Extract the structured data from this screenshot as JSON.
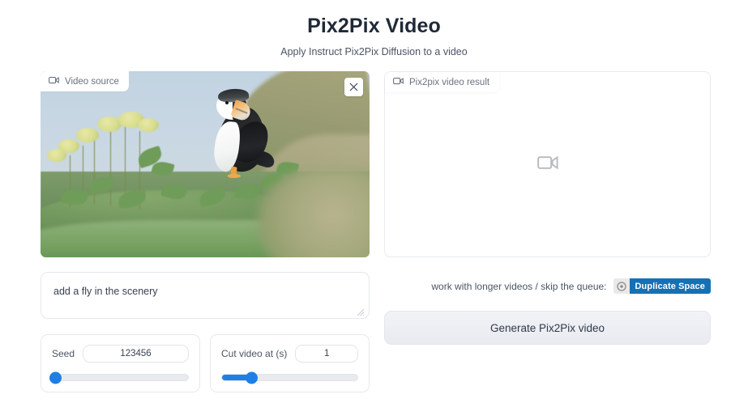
{
  "header": {
    "title": "Pix2Pix Video",
    "subtitle": "Apply Instruct Pix2Pix Diffusion to a video"
  },
  "video_source": {
    "label": "Video source",
    "label_icon": "video-camera-icon",
    "close_icon": "close-icon",
    "scene_description": "Atlantic puffin standing on a grassy coastal slope with yellow-green flowering plants on the left and a blurred grassy hillside on the right under a pale blue sky"
  },
  "prompt": {
    "value": "add a fly in the scenery",
    "placeholder": "",
    "resize_icon": "resize-grip-icon"
  },
  "controls": [
    {
      "name": "seed",
      "label": "Seed",
      "value": "123456",
      "fill_percent": 2,
      "thumb_percent": 2
    },
    {
      "name": "cut-video-at-seconds",
      "label": "Cut video at (s)",
      "value": "1",
      "fill_percent": 22,
      "thumb_percent": 22
    }
  ],
  "result": {
    "label": "Pix2pix video result",
    "label_icon": "video-camera-icon",
    "placeholder_icon": "video-camera-icon"
  },
  "duplicate": {
    "text": "work with longer videos / skip the queue:",
    "badge_icon": "duplicate-space-icon",
    "button_label": "Duplicate Space"
  },
  "generate": {
    "label": "Generate Pix2Pix video"
  },
  "colors": {
    "accent_blue": "#1e80e6",
    "duplicate_button": "#1571b5",
    "page_background": "#ffffff",
    "border": "#e8eaee",
    "text": "#374151",
    "title": "#1f2937"
  }
}
